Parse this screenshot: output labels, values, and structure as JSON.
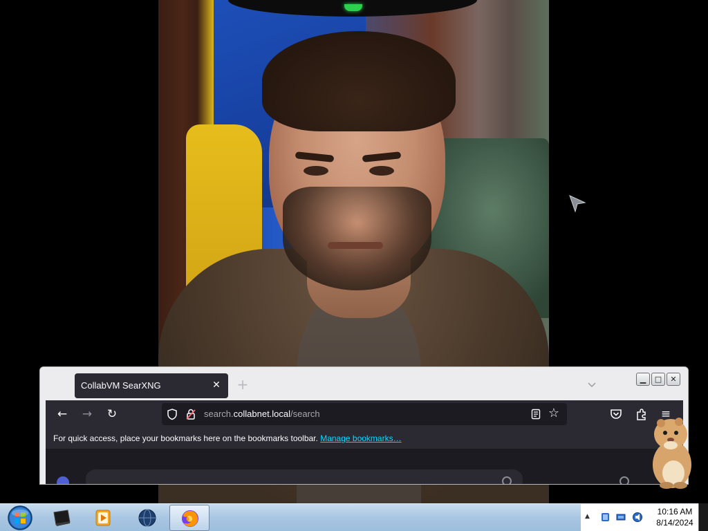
{
  "browser": {
    "tab_title": "CollabVM SearXNG",
    "tab_close_glyph": "✕",
    "new_tab_glyph": "+",
    "url_prefix": "search.",
    "url_host": "collabnet.local",
    "url_path": "/search",
    "bookmarks_message": "For quick access, place your bookmarks here on the bookmarks toolbar.",
    "bookmarks_link": "Manage bookmarks…",
    "nav": {
      "back_glyph": "←",
      "forward_glyph": "→",
      "reload_glyph": "↻",
      "star_glyph": "☆",
      "menu_glyph": "≡"
    },
    "window_buttons": {
      "minimize": "▁",
      "maximize": "□",
      "close": "✕"
    }
  },
  "taskbar": {
    "pinned": [
      "media-center-icon",
      "media-player-icon",
      "globe-icon",
      "firefox-icon"
    ],
    "tray_chevron": "▲"
  },
  "clock": {
    "time": "10:16 AM",
    "date": "8/14/2024"
  },
  "colors": {
    "firefox_dark": "#2b2a33",
    "firefox_darker": "#1c1b22",
    "link_cyan": "#00ddff",
    "taskbar": "#a9c6e2"
  }
}
